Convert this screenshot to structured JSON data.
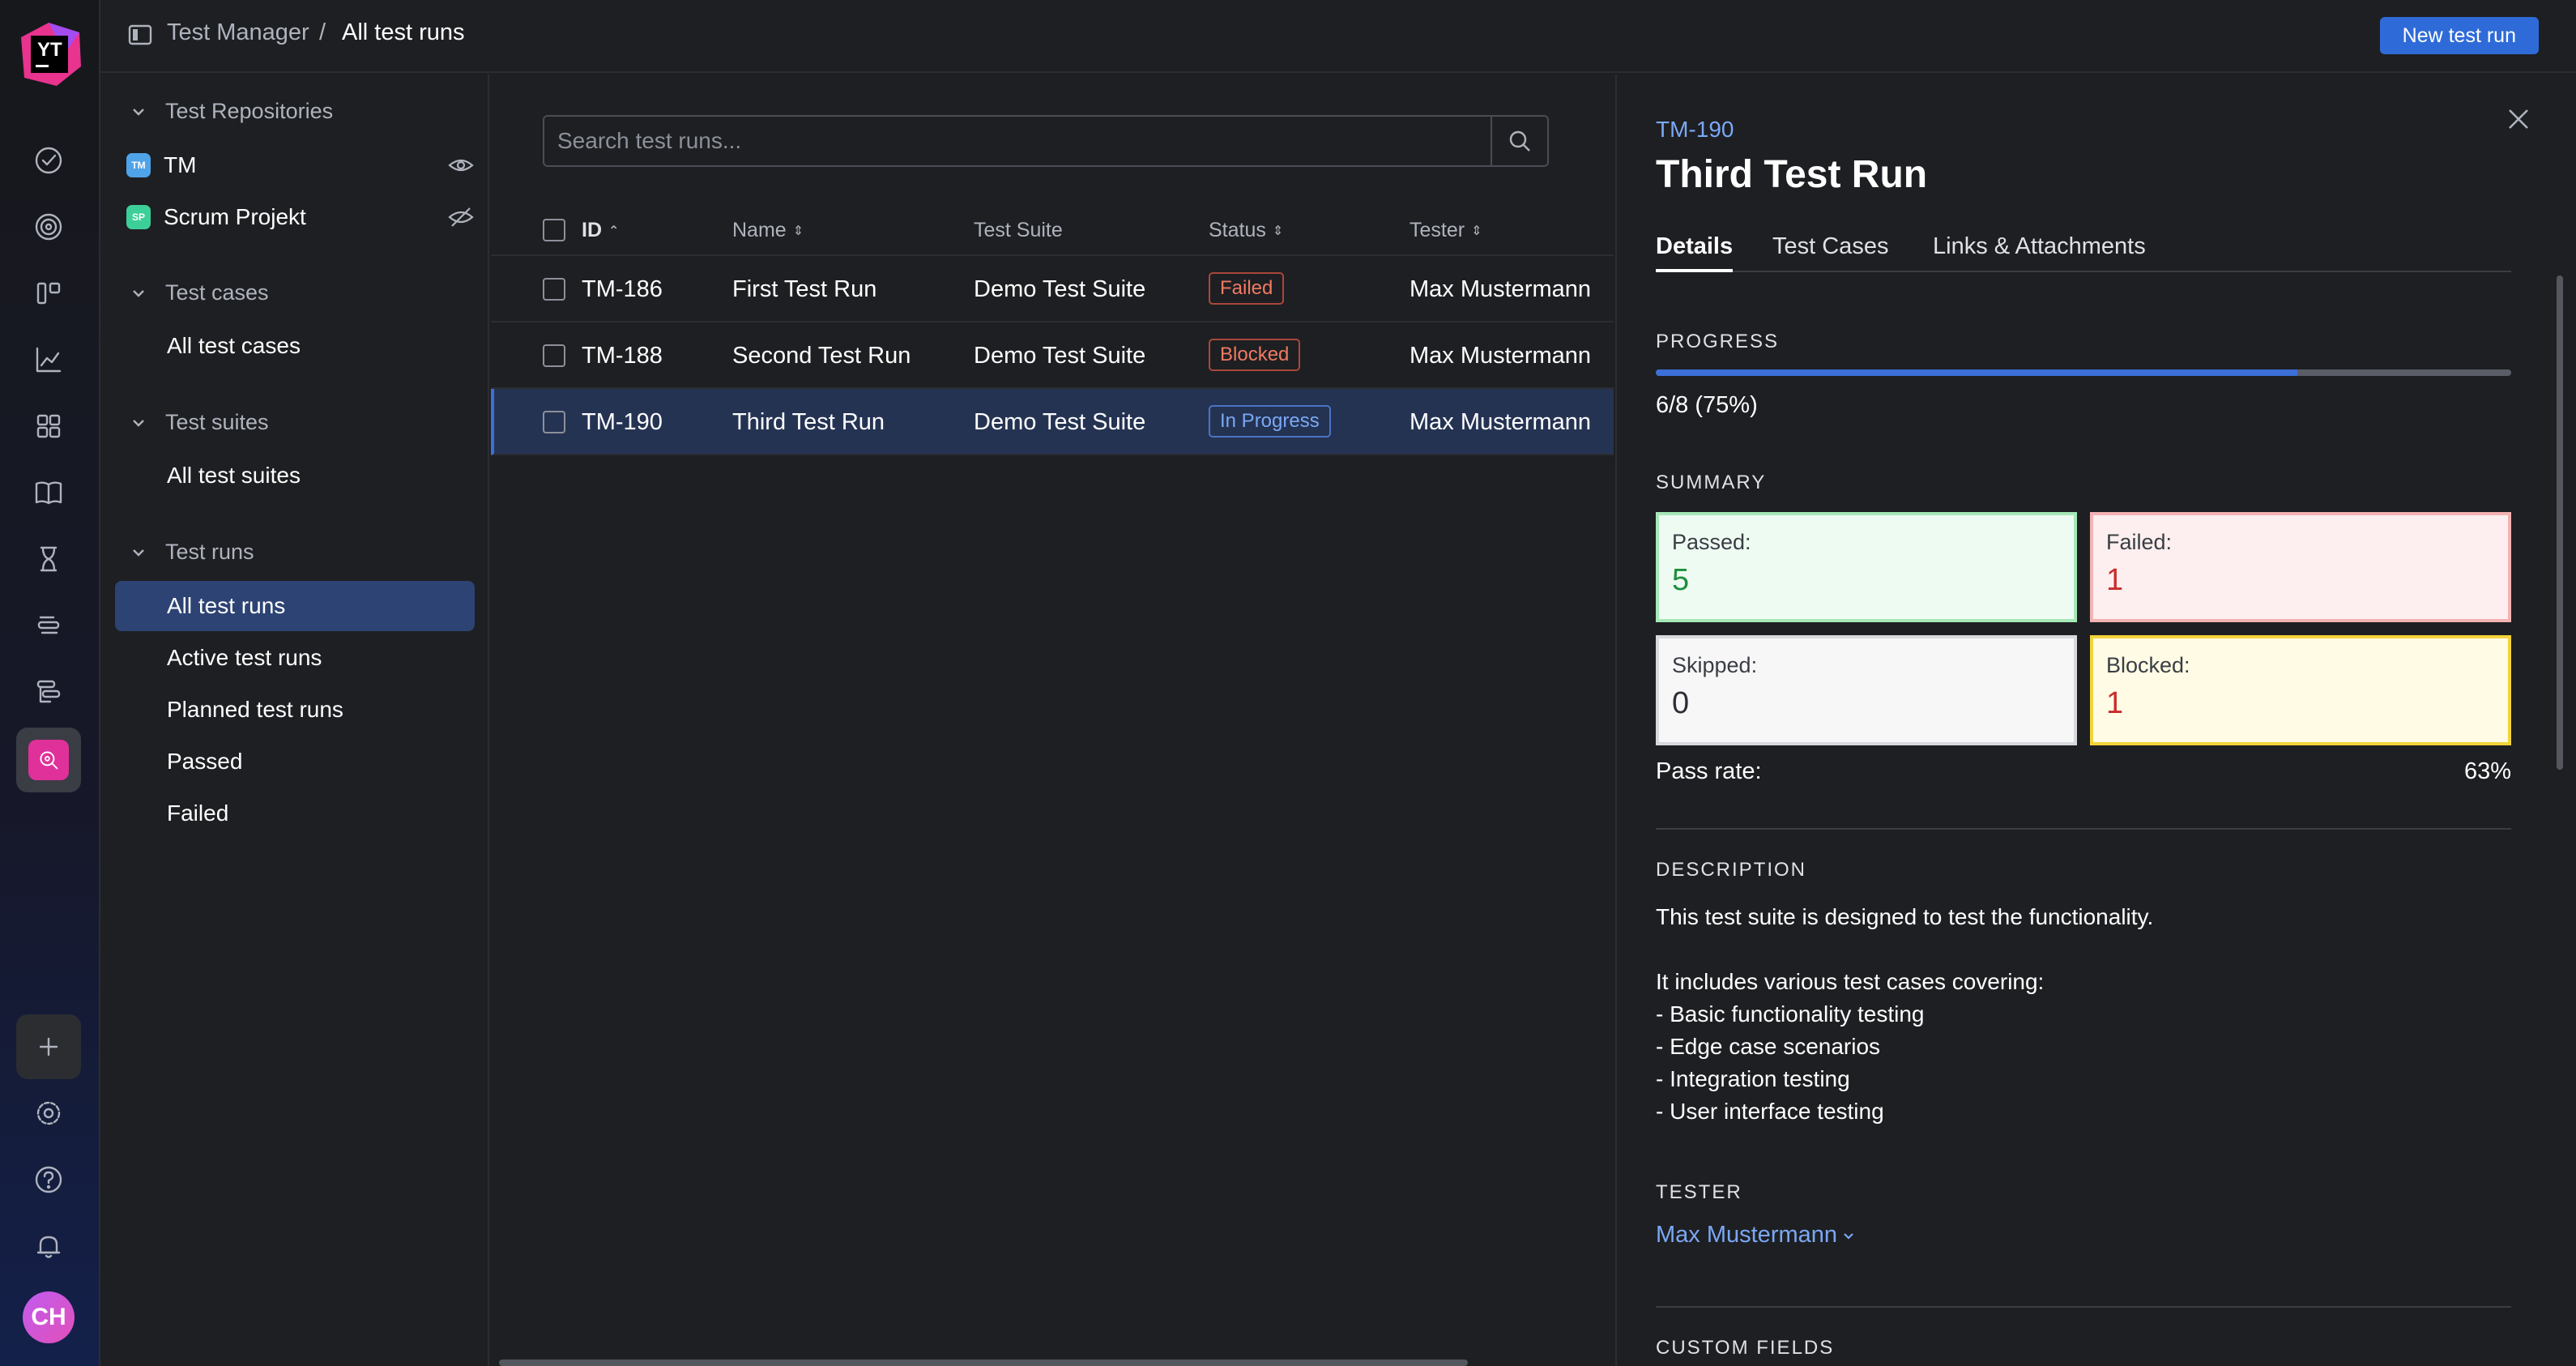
{
  "app": {
    "logo_text": "YT",
    "avatar_initials": "CH"
  },
  "topbar": {
    "breadcrumb_root": "Test Manager",
    "breadcrumb_sep": "/",
    "breadcrumb_current": "All test runs",
    "new_button": "New test run"
  },
  "sidebar": {
    "repositories_heading": "Test Repositories",
    "repos": [
      {
        "badge": "TM",
        "name": "TM",
        "color": "#4fa3e8"
      },
      {
        "badge": "SP",
        "name": "Scrum Projekt",
        "color": "#3ccf9a"
      }
    ],
    "cases_heading": "Test cases",
    "cases_items": [
      "All test cases"
    ],
    "suites_heading": "Test suites",
    "suites_items": [
      "All test suites"
    ],
    "runs_heading": "Test runs",
    "runs_items": [
      "All test runs",
      "Active test runs",
      "Planned test runs",
      "Passed",
      "Failed"
    ]
  },
  "main": {
    "search_placeholder": "Search test runs...",
    "columns": {
      "id": "ID",
      "name": "Name",
      "suite": "Test Suite",
      "status": "Status",
      "tester": "Tester"
    },
    "rows": [
      {
        "id": "TM-186",
        "name": "First Test Run",
        "suite": "Demo Test Suite",
        "status": "Failed",
        "tester": "Max Mustermann"
      },
      {
        "id": "TM-188",
        "name": "Second Test Run",
        "suite": "Demo Test Suite",
        "status": "Blocked",
        "tester": "Max Mustermann"
      },
      {
        "id": "TM-190",
        "name": "Third Test Run",
        "suite": "Demo Test Suite",
        "status": "In Progress",
        "tester": "Max Mustermann"
      }
    ]
  },
  "details": {
    "id": "TM-190",
    "title": "Third Test Run",
    "tabs": [
      "Details",
      "Test Cases",
      "Links & Attachments"
    ],
    "progress_label": "PROGRESS",
    "progress_fraction": 0.75,
    "progress_text": "6/8 (75%)",
    "summary_label": "SUMMARY",
    "summary": {
      "passed_label": "Passed:",
      "passed": "5",
      "failed_label": "Failed:",
      "failed": "1",
      "skipped_label": "Skipped:",
      "skipped": "0",
      "blocked_label": "Blocked:",
      "blocked": "1"
    },
    "pass_rate_label": "Pass rate:",
    "pass_rate": "63%",
    "description_label": "DESCRIPTION",
    "description": "This test suite is designed to test the functionality.\n\nIt includes various test cases covering:\n- Basic functionality testing\n- Edge case scenarios\n- Integration testing\n- User interface testing",
    "tester_label": "TESTER",
    "tester": "Max Mustermann",
    "custom_fields_label": "CUSTOM FIELDS"
  }
}
